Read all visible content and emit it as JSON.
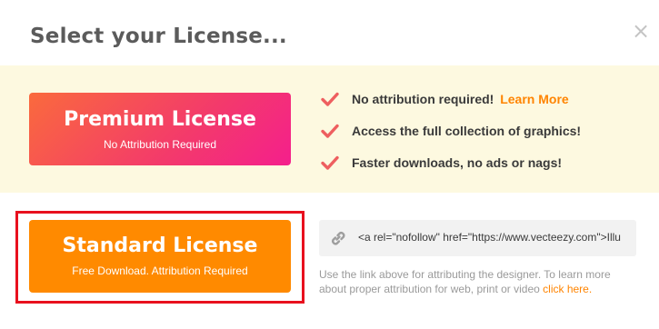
{
  "modal": {
    "title": "Select your License...",
    "close_glyph": "×"
  },
  "premium": {
    "title": "Premium License",
    "subtitle": "No Attribution Required",
    "gradient": [
      "#fa6a3d",
      "#f33a6b",
      "#f41f8c"
    ]
  },
  "features": [
    {
      "text": "No attribution required!",
      "link": "Learn More"
    },
    {
      "text": "Access the full collection of graphics!"
    },
    {
      "text": "Faster downloads, no ads or nags!"
    }
  ],
  "standard": {
    "title": "Standard License",
    "subtitle": "Free Download. Attribution Required",
    "color": "#ff8a00"
  },
  "attribution": {
    "code": "<a rel=\"nofollow\" href=\"https://www.vecteezy.com\">Illu",
    "note": "Use the link above for attributing the designer. To learn more about proper attribution for web, print or video",
    "link": "click here."
  },
  "colors": {
    "accent": "#ff8400",
    "check": "#ee5f5f",
    "highlight": "#e8101e",
    "band": "#fdf9e0"
  },
  "icons": {
    "check": "check-icon",
    "link": "link-icon",
    "close": "close-icon"
  }
}
